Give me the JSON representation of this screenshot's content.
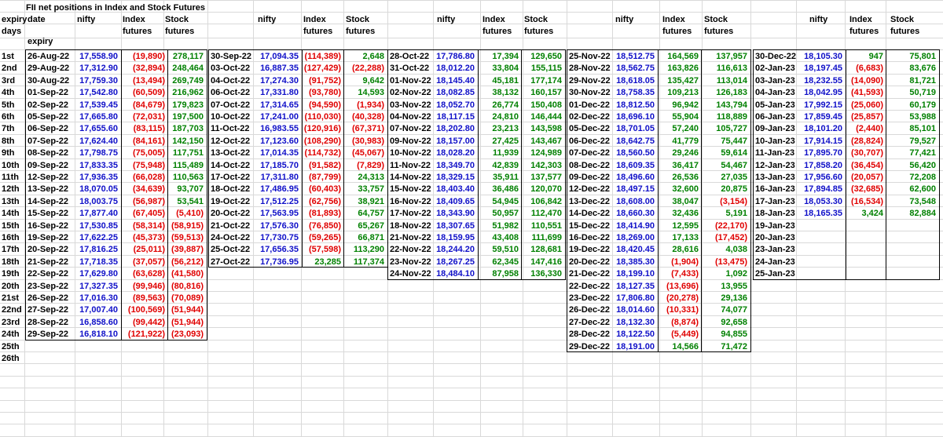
{
  "title": "FII net positions in Index and Stock Futures",
  "header": {
    "expiry_line1": "expiry",
    "days": "days",
    "date": "date",
    "expiry_line3": "expiry",
    "nifty": "nifty",
    "index_line1": "Index",
    "index_line2": "futures",
    "stock_line1": "Stock",
    "stock_line2": "futures"
  },
  "days": [
    "1st",
    "2nd",
    "3rd",
    "4th",
    "5th",
    "6th",
    "7th",
    "8th",
    "9th",
    "10th",
    "11th",
    "12th",
    "13th",
    "14th",
    "15th",
    "16th",
    "17th",
    "18th",
    "19th",
    "20th",
    "21st",
    "22nd",
    "23rd",
    "24th",
    "25th",
    "26th"
  ],
  "groups": [
    {
      "rows": [
        [
          "26-Aug-22",
          "17,558.90",
          "(19,890)",
          "278,117"
        ],
        [
          "29-Aug-22",
          "17,312.90",
          "(32,894)",
          "248,464"
        ],
        [
          "30-Aug-22",
          "17,759.30",
          "(13,494)",
          "269,749"
        ],
        [
          "01-Sep-22",
          "17,542.80",
          "(60,509)",
          "216,962"
        ],
        [
          "02-Sep-22",
          "17,539.45",
          "(84,679)",
          "179,823"
        ],
        [
          "05-Sep-22",
          "17,665.80",
          "(72,031)",
          "197,500"
        ],
        [
          "06-Sep-22",
          "17,655.60",
          "(83,115)",
          "187,703"
        ],
        [
          "07-Sep-22",
          "17,624.40",
          "(84,161)",
          "142,150"
        ],
        [
          "08-Sep-22",
          "17,798.75",
          "(75,005)",
          "117,751"
        ],
        [
          "09-Sep-22",
          "17,833.35",
          "(75,948)",
          "115,489"
        ],
        [
          "12-Sep-22",
          "17,936.35",
          "(66,028)",
          "110,563"
        ],
        [
          "13-Sep-22",
          "18,070.05",
          "(34,639)",
          "93,707"
        ],
        [
          "14-Sep-22",
          "18,003.75",
          "(56,987)",
          "53,541"
        ],
        [
          "15-Sep-22",
          "17,877.40",
          "(67,405)",
          "(5,410)"
        ],
        [
          "16-Sep-22",
          "17,530.85",
          "(58,314)",
          "(58,915)"
        ],
        [
          "19-Sep-22",
          "17,622.25",
          "(45,373)",
          "(59,513)"
        ],
        [
          "20-Sep-22",
          "17,816.25",
          "(25,011)",
          "(39,887)"
        ],
        [
          "21-Sep-22",
          "17,718.35",
          "(37,057)",
          "(56,212)"
        ],
        [
          "22-Sep-22",
          "17,629.80",
          "(63,628)",
          "(41,580)"
        ],
        [
          "23-Sep-22",
          "17,327.35",
          "(99,946)",
          "(80,816)"
        ],
        [
          "26-Sep-22",
          "17,016.30",
          "(89,563)",
          "(70,089)"
        ],
        [
          "27-Sep-22",
          "17,007.40",
          "(100,569)",
          "(51,944)"
        ],
        [
          "28-Sep-22",
          "16,858.60",
          "(99,442)",
          "(51,944)"
        ],
        [
          "29-Sep-22",
          "16,818.10",
          "(121,922)",
          "(23,093)"
        ]
      ]
    },
    {
      "rows": [
        [
          "30-Sep-22",
          "17,094.35",
          "(114,389)",
          "2,648"
        ],
        [
          "03-Oct-22",
          "16,887.35",
          "(127,429)",
          "(22,288)"
        ],
        [
          "04-Oct-22",
          "17,274.30",
          "(91,752)",
          "9,642"
        ],
        [
          "06-Oct-22",
          "17,331.80",
          "(93,780)",
          "14,593"
        ],
        [
          "07-Oct-22",
          "17,314.65",
          "(94,590)",
          "(1,934)"
        ],
        [
          "10-Oct-22",
          "17,241.00",
          "(110,030)",
          "(40,328)"
        ],
        [
          "11-Oct-22",
          "16,983.55",
          "(120,916)",
          "(67,371)"
        ],
        [
          "12-Oct-22",
          "17,123.60",
          "(108,290)",
          "(30,983)"
        ],
        [
          "13-Oct-22",
          "17,014.35",
          "(114,732)",
          "(45,067)"
        ],
        [
          "14-Oct-22",
          "17,185.70",
          "(91,582)",
          "(7,829)"
        ],
        [
          "17-Oct-22",
          "17,311.80",
          "(87,799)",
          "24,313"
        ],
        [
          "18-Oct-22",
          "17,486.95",
          "(60,403)",
          "33,757"
        ],
        [
          "19-Oct-22",
          "17,512.25",
          "(62,756)",
          "38,921"
        ],
        [
          "20-Oct-22",
          "17,563.95",
          "(81,893)",
          "64,757"
        ],
        [
          "21-Oct-22",
          "17,576.30",
          "(76,850)",
          "65,267"
        ],
        [
          "24-Oct-22",
          "17,730.75",
          "(59,265)",
          "66,871"
        ],
        [
          "25-Oct-22",
          "17,656.35",
          "(57,598)",
          "113,290"
        ],
        [
          "27-Oct-22",
          "17,736.95",
          "23,285",
          "117,374"
        ]
      ]
    },
    {
      "rows": [
        [
          "28-Oct-22",
          "17,786.80",
          "17,394",
          "129,650"
        ],
        [
          "31-Oct-22",
          "18,012.20",
          "33,804",
          "155,115"
        ],
        [
          "01-Nov-22",
          "18,145.40",
          "45,181",
          "177,174"
        ],
        [
          "02-Nov-22",
          "18,082.85",
          "38,132",
          "160,157"
        ],
        [
          "03-Nov-22",
          "18,052.70",
          "26,774",
          "150,408"
        ],
        [
          "04-Nov-22",
          "18,117.15",
          "24,810",
          "146,444"
        ],
        [
          "07-Nov-22",
          "18,202.80",
          "23,213",
          "143,598"
        ],
        [
          "09-Nov-22",
          "18,157.00",
          "27,425",
          "143,467"
        ],
        [
          "10-Nov-22",
          "18,028.20",
          "11,939",
          "124,989"
        ],
        [
          "11-Nov-22",
          "18,349.70",
          "42,839",
          "142,303"
        ],
        [
          "14-Nov-22",
          "18,329.15",
          "35,911",
          "137,577"
        ],
        [
          "15-Nov-22",
          "18,403.40",
          "36,486",
          "120,070"
        ],
        [
          "16-Nov-22",
          "18,409.65",
          "54,945",
          "106,842"
        ],
        [
          "17-Nov-22",
          "18,343.90",
          "50,957",
          "112,470"
        ],
        [
          "18-Nov-22",
          "18,307.65",
          "51,982",
          "110,551"
        ],
        [
          "21-Nov-22",
          "18,159.95",
          "43,408",
          "111,699"
        ],
        [
          "22-Nov-22",
          "18,244.20",
          "59,510",
          "128,681"
        ],
        [
          "23-Nov-22",
          "18,267.25",
          "62,345",
          "147,416"
        ],
        [
          "24-Nov-22",
          "18,484.10",
          "87,958",
          "136,330"
        ]
      ]
    },
    {
      "rows": [
        [
          "25-Nov-22",
          "18,512.75",
          "164,569",
          "137,957"
        ],
        [
          "28-Nov-22",
          "18,562.75",
          "163,826",
          "116,613"
        ],
        [
          "29-Nov-22",
          "18,618.05",
          "135,427",
          "113,014"
        ],
        [
          "30-Nov-22",
          "18,758.35",
          "109,213",
          "126,183"
        ],
        [
          "01-Dec-22",
          "18,812.50",
          "96,942",
          "143,794"
        ],
        [
          "02-Dec-22",
          "18,696.10",
          "55,904",
          "118,889"
        ],
        [
          "05-Dec-22",
          "18,701.05",
          "57,240",
          "105,727"
        ],
        [
          "06-Dec-22",
          "18,642.75",
          "41,779",
          "75,447"
        ],
        [
          "07-Dec-22",
          "18,560.50",
          "29,246",
          "59,614"
        ],
        [
          "08-Dec-22",
          "18,609.35",
          "36,417",
          "54,467"
        ],
        [
          "09-Dec-22",
          "18,496.60",
          "26,536",
          "27,035"
        ],
        [
          "12-Dec-22",
          "18,497.15",
          "32,600",
          "20,875"
        ],
        [
          "13-Dec-22",
          "18,608.00",
          "38,047",
          "(3,154)"
        ],
        [
          "14-Dec-22",
          "18,660.30",
          "32,436",
          "5,191"
        ],
        [
          "15-Dec-22",
          "18,414.90",
          "12,595",
          "(22,170)"
        ],
        [
          "16-Dec-22",
          "18,269.00",
          "17,133",
          "(17,452)"
        ],
        [
          "19-Dec-22",
          "18,420.45",
          "28,616",
          "4,038"
        ],
        [
          "20-Dec-22",
          "18,385.30",
          "(1,904)",
          "(13,475)"
        ],
        [
          "21-Dec-22",
          "18,199.10",
          "(7,433)",
          "1,092"
        ],
        [
          "22-Dec-22",
          "18,127.35",
          "(13,696)",
          "13,955"
        ],
        [
          "23-Dec-22",
          "17,806.80",
          "(20,278)",
          "29,136"
        ],
        [
          "26-Dec-22",
          "18,014.60",
          "(10,331)",
          "74,077"
        ],
        [
          "27-Dec-22",
          "18,132.30",
          "(8,874)",
          "92,658"
        ],
        [
          "28-Dec-22",
          "18,122.50",
          "(5,449)",
          "94,855"
        ],
        [
          "29-Dec-22",
          "18,191.00",
          "14,566",
          "71,472"
        ]
      ]
    },
    {
      "rows": [
        [
          "30-Dec-22",
          "18,105.30",
          "947",
          "75,801"
        ],
        [
          "02-Jan-23",
          "18,197.45",
          "(6,683)",
          "83,676"
        ],
        [
          "03-Jan-23",
          "18,232.55",
          "(14,090)",
          "81,721"
        ],
        [
          "04-Jan-23",
          "18,042.95",
          "(41,593)",
          "50,719"
        ],
        [
          "05-Jan-23",
          "17,992.15",
          "(25,060)",
          "60,179"
        ],
        [
          "06-Jan-23",
          "17,859.45",
          "(25,857)",
          "53,988"
        ],
        [
          "09-Jan-23",
          "18,101.20",
          "(2,440)",
          "85,101"
        ],
        [
          "10-Jan-23",
          "17,914.15",
          "(28,824)",
          "79,527"
        ],
        [
          "11-Jan-23",
          "17,895.70",
          "(30,707)",
          "77,421"
        ],
        [
          "12-Jan-23",
          "17,858.20",
          "(36,454)",
          "56,420"
        ],
        [
          "13-Jan-23",
          "17,956.60",
          "(20,057)",
          "72,208"
        ],
        [
          "16-Jan-23",
          "17,894.85",
          "(32,685)",
          "62,600"
        ],
        [
          "17-Jan-23",
          "18,053.30",
          "(16,534)",
          "73,548"
        ],
        [
          "18-Jan-23",
          "18,165.35",
          "3,424",
          "82,884"
        ],
        [
          "19-Jan-23",
          "",
          "",
          ""
        ],
        [
          "20-Jan-23",
          "",
          "",
          ""
        ],
        [
          "23-Jan-23",
          "",
          "",
          ""
        ],
        [
          "24-Jan-23",
          "",
          "",
          ""
        ],
        [
          "25-Jan-23",
          "",
          "",
          ""
        ]
      ]
    }
  ]
}
